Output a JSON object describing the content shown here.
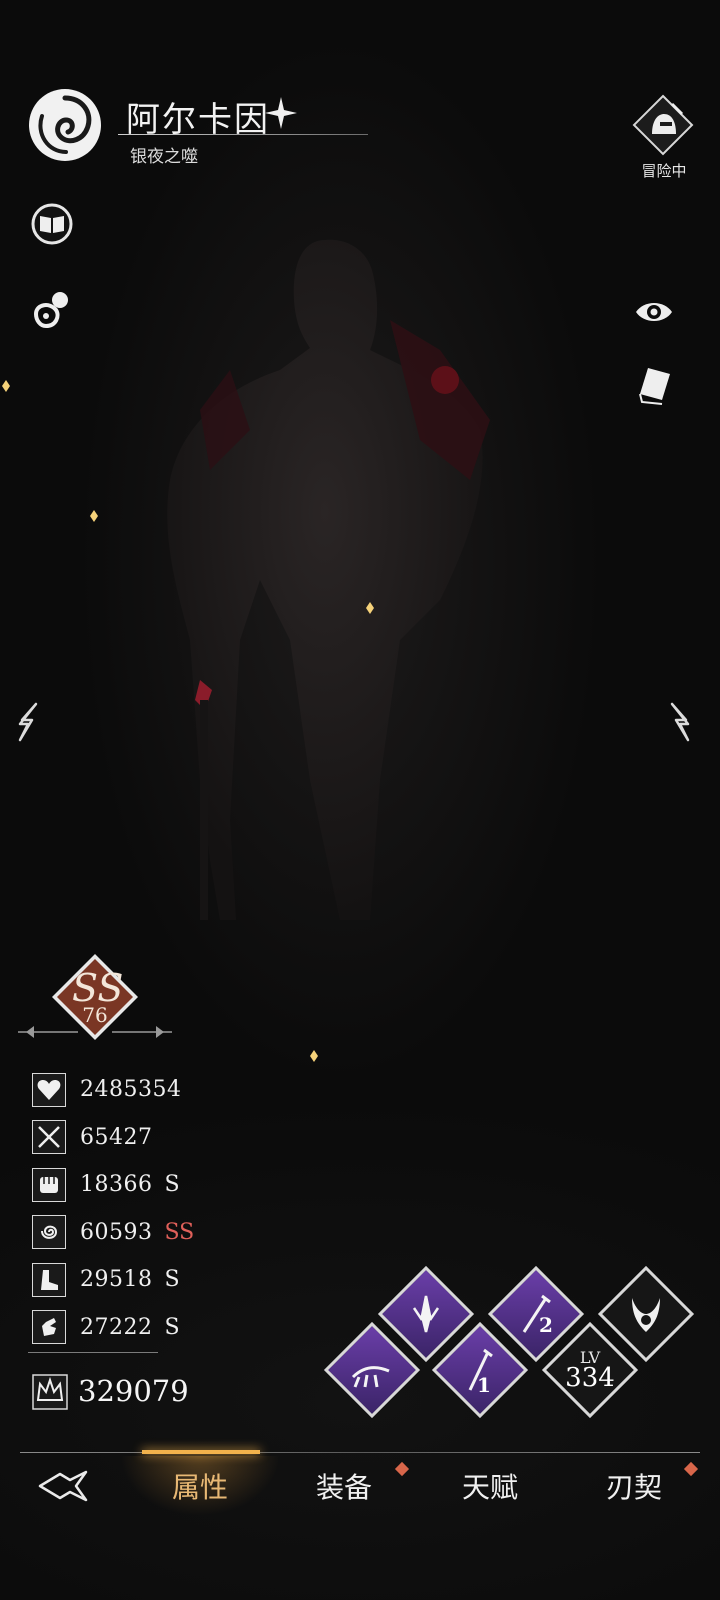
{
  "character": {
    "name": "阿尔卡因",
    "title": "银夜之噬"
  },
  "status": {
    "adventure_label": "冒险中"
  },
  "rank": {
    "grade": "SS",
    "level": "76"
  },
  "stats": [
    {
      "icon": "heart-icon",
      "value": "2485354",
      "grade": ""
    },
    {
      "icon": "crossed-swords-icon",
      "value": "65427",
      "grade": ""
    },
    {
      "icon": "fist-icon",
      "value": "18366",
      "grade": "S"
    },
    {
      "icon": "spiral-icon",
      "value": "60593",
      "grade": "SS"
    },
    {
      "icon": "boot-icon",
      "value": "29518",
      "grade": "S"
    },
    {
      "icon": "hand-icon",
      "value": "27222",
      "grade": "S"
    }
  ],
  "power": {
    "value": "329079"
  },
  "skills": {
    "level_label": "LV",
    "level_value": "334",
    "slot1_number": "1",
    "slot2_number": "2"
  },
  "nav": {
    "tabs": [
      "属性",
      "装备",
      "天赋",
      "刃契"
    ],
    "active_index": 0
  },
  "colors": {
    "accent": "#e8b874",
    "grade_ss": "#e0605a",
    "skill_purple": "#6a3ea8",
    "notify_dot": "#d8664a"
  }
}
